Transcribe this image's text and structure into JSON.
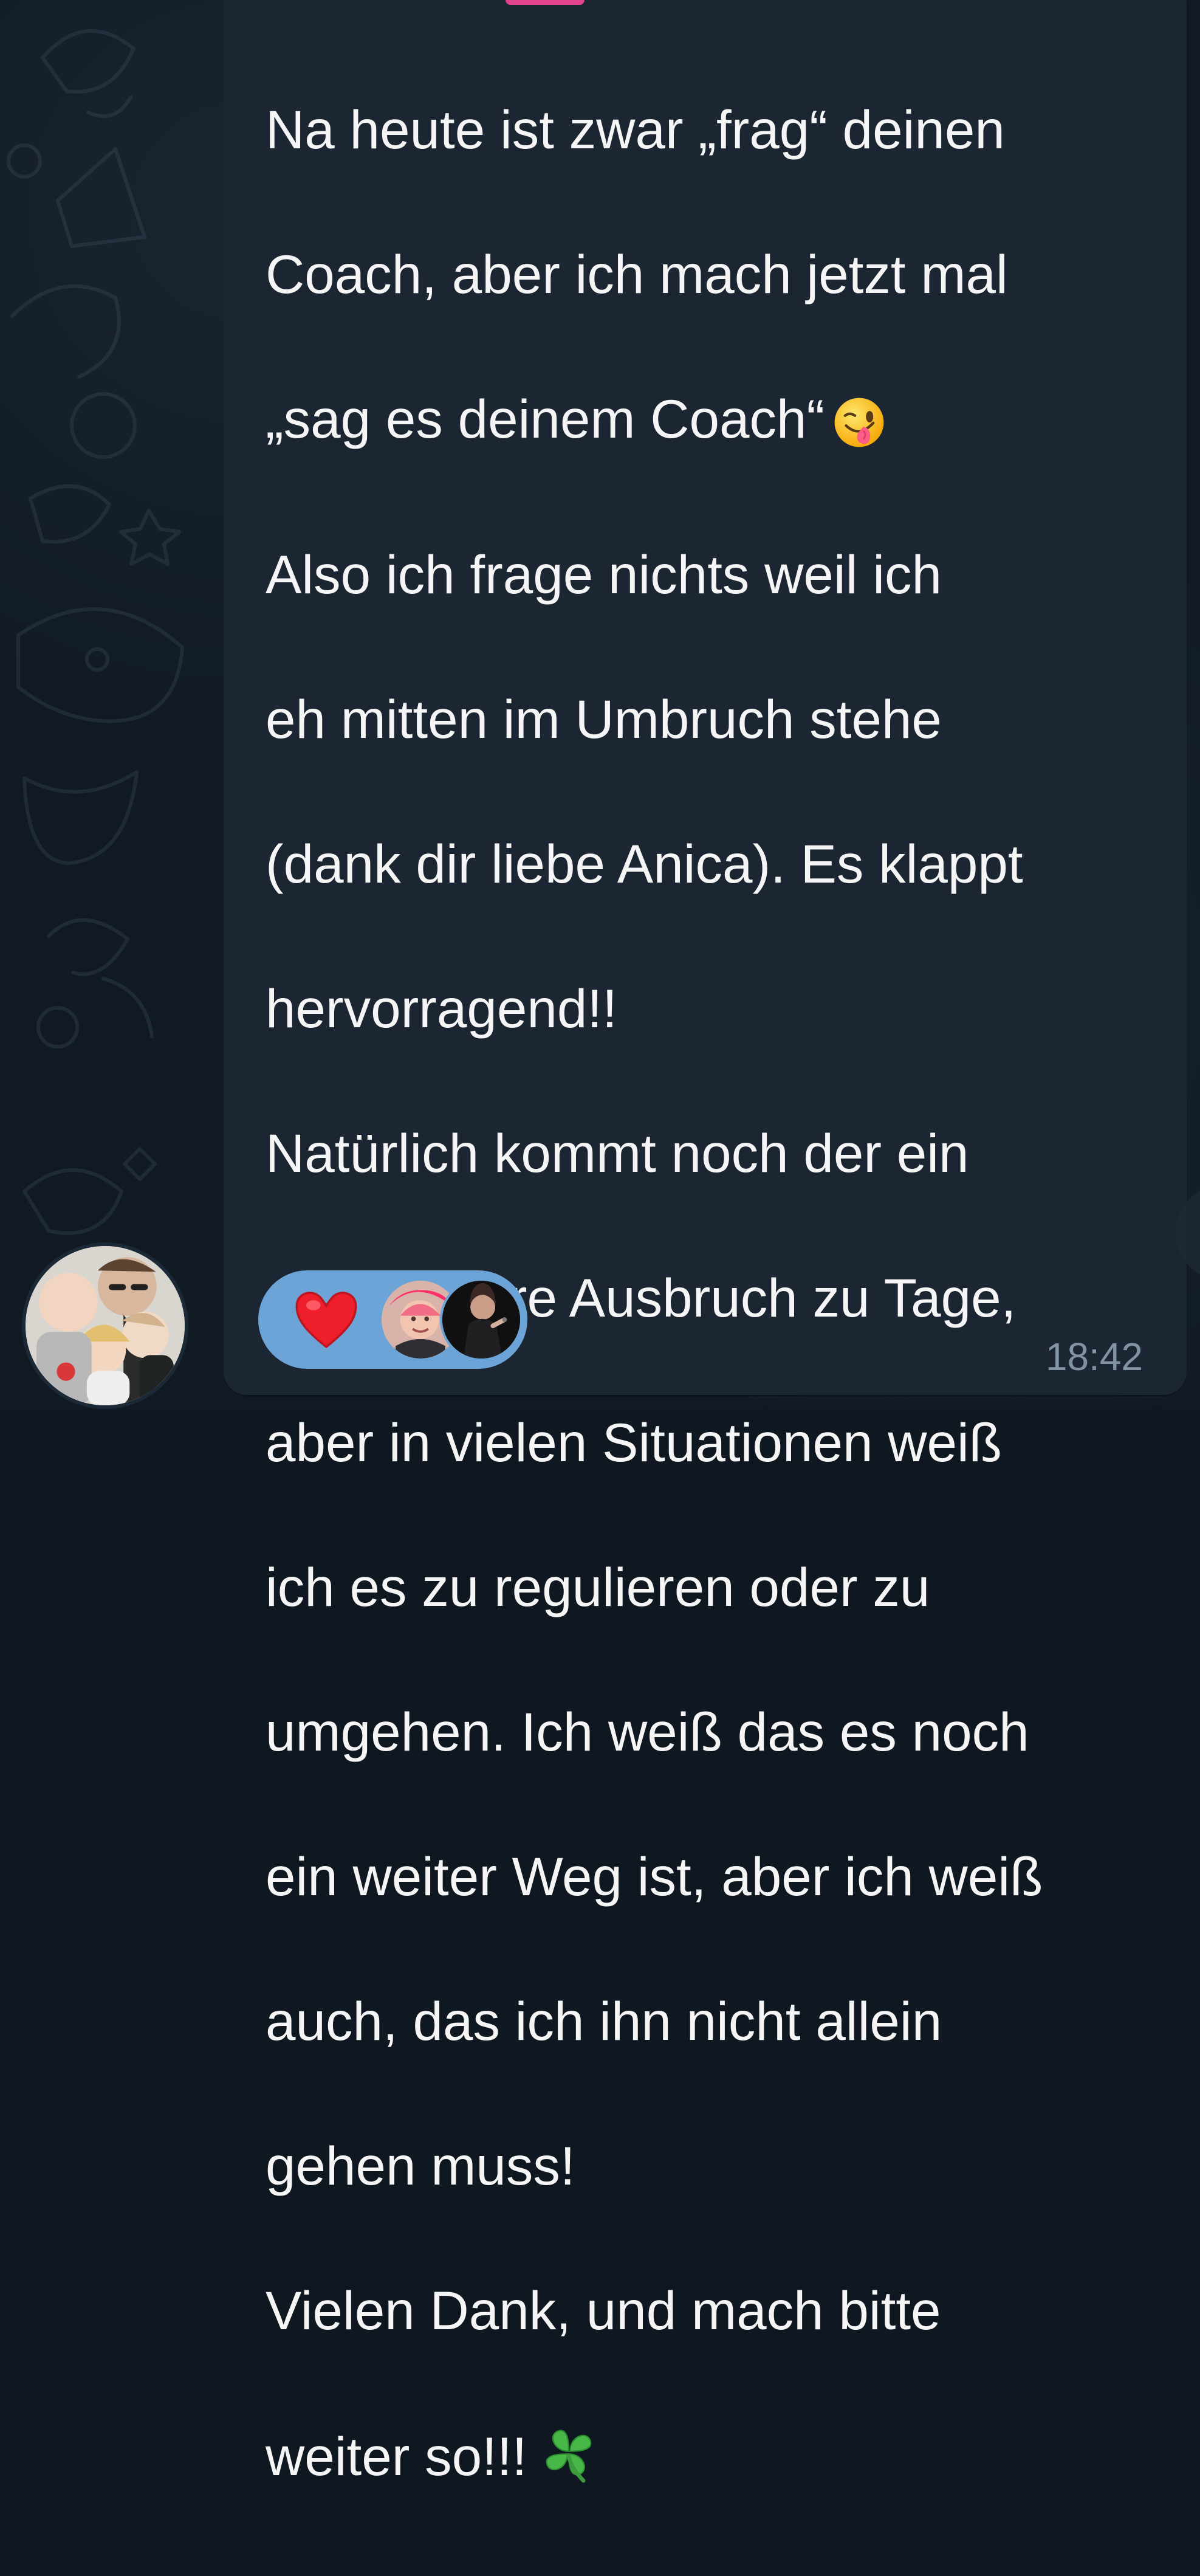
{
  "message": {
    "lines": [
      "Na heute ist zwar „frag“ deinen",
      "Coach, aber ich mach jetzt mal",
      "„sag es deinem Coach“",
      "Also ich frage nichts weil ich",
      "eh mitten im Umbruch stehe",
      "(dank dir liebe Anica). Es klappt",
      "hervorragend!!",
      "Natürlich kommt noch der ein",
      "oder andere Ausbruch zu Tage,",
      "aber in vielen Situationen weiß",
      "ich es zu regulieren oder zu",
      "umgehen. Ich weiß das es noch",
      "ein weiter Weg ist, aber ich weiß",
      "auch, das ich ihn nicht allein",
      "gehen muss!",
      "Vielen Dank, und mach bitte",
      "weiter so!!!"
    ],
    "time": "18:42"
  },
  "icons": {
    "wink_emoji": "winking-face-with-tongue",
    "clover_emoji": "four-leaf-clover",
    "reaction": "red-heart"
  },
  "colors": {
    "bubble": "#1b2632",
    "text": "#f5f5f5",
    "reaction_pill": "#6da4d7",
    "timestamp": "#8193a3",
    "heart": "#ef1e2b"
  }
}
